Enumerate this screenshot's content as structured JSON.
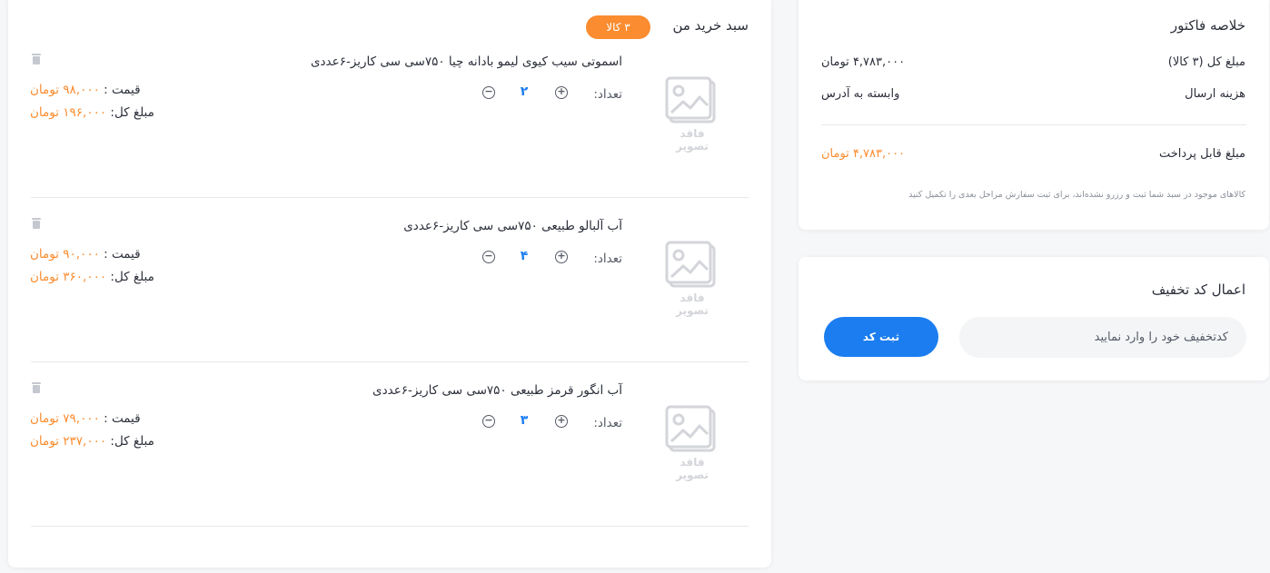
{
  "cart": {
    "title": "سبد خرید من",
    "count_badge": "۳ کالا",
    "quantity_label": "تعداد:",
    "unit_price_label": "قیمت :",
    "total_label": "مبلغ کل:",
    "placeholder_caption": "فاقد تصویر",
    "items": [
      {
        "name": "اسموتی سیب کیوی لیمو بادانه چیا ۷۵۰سی سی کاریز-۶عددی",
        "quantity": "۲",
        "unit_price": "۹۸,۰۰۰ تومان",
        "total": "۱۹۶,۰۰۰ تومان"
      },
      {
        "name": "آب آلبالو طبیعی ۷۵۰سی سی کاریز-۶عددی",
        "quantity": "۴",
        "unit_price": "۹۰,۰۰۰ تومان",
        "total": "۳۶۰,۰۰۰ تومان"
      },
      {
        "name": "آب انگور قرمز طبیعی ۷۵۰سی سی کاریز-۶عددی",
        "quantity": "۳",
        "unit_price": "۷۹,۰۰۰ تومان",
        "total": "۲۳۷,۰۰۰ تومان"
      }
    ]
  },
  "summary": {
    "title": "خلاصه فاکتور",
    "subtotal_label": "مبلغ کل (۳ کالا)",
    "subtotal_value": "۴,۷۸۳,۰۰۰ تومان",
    "shipping_label": "هزینه ارسال",
    "shipping_value": "وابسته به آدرس",
    "payable_label": "مبلغ قابل پرداخت",
    "payable_value": "۴,۷۸۳,۰۰۰ تومان",
    "note": "کالاهای موجود در سبد شما ثبت و رزرو نشده‌اند، برای ثبت سفارش مراحل بعدی را تکمیل کنید"
  },
  "discount": {
    "title": "اعمال کد تخفیف",
    "placeholder": "کدتخفیف خود را وارد نمایید",
    "button_label": "ثبت کد"
  },
  "colors": {
    "accent_orange": "#fb8c2f",
    "primary_blue": "#1b7df0",
    "page_background": "#f6f7f9"
  },
  "icons": {
    "trash": "trash-icon",
    "plus": "plus-circle-icon",
    "minus": "minus-circle-icon",
    "image_placeholder": "image-placeholder-icon"
  }
}
